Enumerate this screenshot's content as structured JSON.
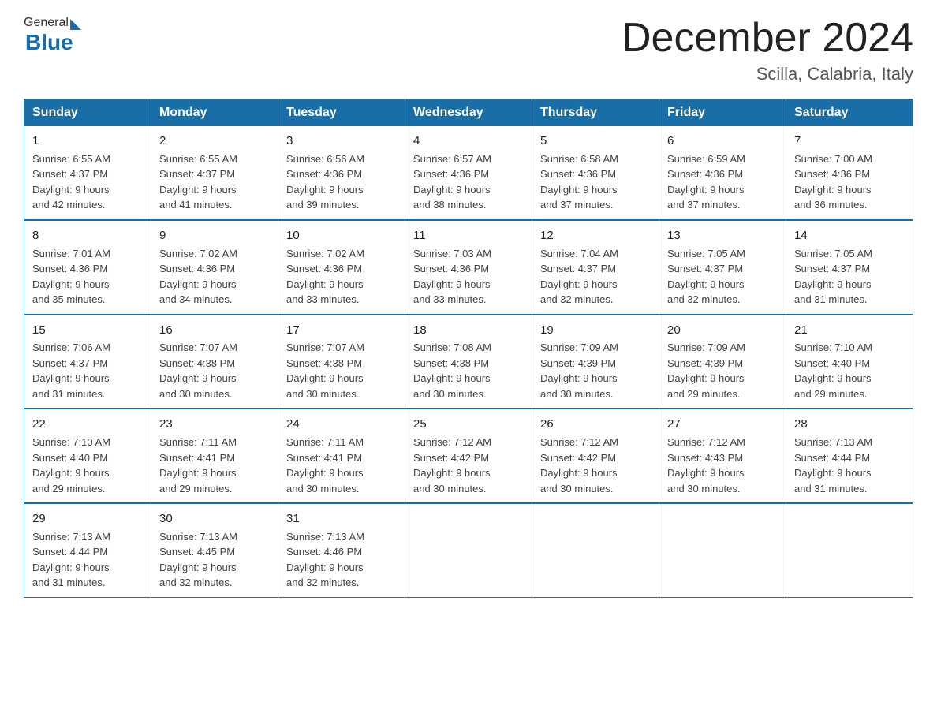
{
  "header": {
    "logo_general": "General",
    "logo_blue": "Blue",
    "title": "December 2024",
    "location": "Scilla, Calabria, Italy"
  },
  "calendar": {
    "days_of_week": [
      "Sunday",
      "Monday",
      "Tuesday",
      "Wednesday",
      "Thursday",
      "Friday",
      "Saturday"
    ],
    "weeks": [
      [
        {
          "day": "1",
          "sunrise": "6:55 AM",
          "sunset": "4:37 PM",
          "daylight": "9 hours and 42 minutes."
        },
        {
          "day": "2",
          "sunrise": "6:55 AM",
          "sunset": "4:37 PM",
          "daylight": "9 hours and 41 minutes."
        },
        {
          "day": "3",
          "sunrise": "6:56 AM",
          "sunset": "4:36 PM",
          "daylight": "9 hours and 39 minutes."
        },
        {
          "day": "4",
          "sunrise": "6:57 AM",
          "sunset": "4:36 PM",
          "daylight": "9 hours and 38 minutes."
        },
        {
          "day": "5",
          "sunrise": "6:58 AM",
          "sunset": "4:36 PM",
          "daylight": "9 hours and 37 minutes."
        },
        {
          "day": "6",
          "sunrise": "6:59 AM",
          "sunset": "4:36 PM",
          "daylight": "9 hours and 37 minutes."
        },
        {
          "day": "7",
          "sunrise": "7:00 AM",
          "sunset": "4:36 PM",
          "daylight": "9 hours and 36 minutes."
        }
      ],
      [
        {
          "day": "8",
          "sunrise": "7:01 AM",
          "sunset": "4:36 PM",
          "daylight": "9 hours and 35 minutes."
        },
        {
          "day": "9",
          "sunrise": "7:02 AM",
          "sunset": "4:36 PM",
          "daylight": "9 hours and 34 minutes."
        },
        {
          "day": "10",
          "sunrise": "7:02 AM",
          "sunset": "4:36 PM",
          "daylight": "9 hours and 33 minutes."
        },
        {
          "day": "11",
          "sunrise": "7:03 AM",
          "sunset": "4:36 PM",
          "daylight": "9 hours and 33 minutes."
        },
        {
          "day": "12",
          "sunrise": "7:04 AM",
          "sunset": "4:37 PM",
          "daylight": "9 hours and 32 minutes."
        },
        {
          "day": "13",
          "sunrise": "7:05 AM",
          "sunset": "4:37 PM",
          "daylight": "9 hours and 32 minutes."
        },
        {
          "day": "14",
          "sunrise": "7:05 AM",
          "sunset": "4:37 PM",
          "daylight": "9 hours and 31 minutes."
        }
      ],
      [
        {
          "day": "15",
          "sunrise": "7:06 AM",
          "sunset": "4:37 PM",
          "daylight": "9 hours and 31 minutes."
        },
        {
          "day": "16",
          "sunrise": "7:07 AM",
          "sunset": "4:38 PM",
          "daylight": "9 hours and 30 minutes."
        },
        {
          "day": "17",
          "sunrise": "7:07 AM",
          "sunset": "4:38 PM",
          "daylight": "9 hours and 30 minutes."
        },
        {
          "day": "18",
          "sunrise": "7:08 AM",
          "sunset": "4:38 PM",
          "daylight": "9 hours and 30 minutes."
        },
        {
          "day": "19",
          "sunrise": "7:09 AM",
          "sunset": "4:39 PM",
          "daylight": "9 hours and 30 minutes."
        },
        {
          "day": "20",
          "sunrise": "7:09 AM",
          "sunset": "4:39 PM",
          "daylight": "9 hours and 29 minutes."
        },
        {
          "day": "21",
          "sunrise": "7:10 AM",
          "sunset": "4:40 PM",
          "daylight": "9 hours and 29 minutes."
        }
      ],
      [
        {
          "day": "22",
          "sunrise": "7:10 AM",
          "sunset": "4:40 PM",
          "daylight": "9 hours and 29 minutes."
        },
        {
          "day": "23",
          "sunrise": "7:11 AM",
          "sunset": "4:41 PM",
          "daylight": "9 hours and 29 minutes."
        },
        {
          "day": "24",
          "sunrise": "7:11 AM",
          "sunset": "4:41 PM",
          "daylight": "9 hours and 30 minutes."
        },
        {
          "day": "25",
          "sunrise": "7:12 AM",
          "sunset": "4:42 PM",
          "daylight": "9 hours and 30 minutes."
        },
        {
          "day": "26",
          "sunrise": "7:12 AM",
          "sunset": "4:42 PM",
          "daylight": "9 hours and 30 minutes."
        },
        {
          "day": "27",
          "sunrise": "7:12 AM",
          "sunset": "4:43 PM",
          "daylight": "9 hours and 30 minutes."
        },
        {
          "day": "28",
          "sunrise": "7:13 AM",
          "sunset": "4:44 PM",
          "daylight": "9 hours and 31 minutes."
        }
      ],
      [
        {
          "day": "29",
          "sunrise": "7:13 AM",
          "sunset": "4:44 PM",
          "daylight": "9 hours and 31 minutes."
        },
        {
          "day": "30",
          "sunrise": "7:13 AM",
          "sunset": "4:45 PM",
          "daylight": "9 hours and 32 minutes."
        },
        {
          "day": "31",
          "sunrise": "7:13 AM",
          "sunset": "4:46 PM",
          "daylight": "9 hours and 32 minutes."
        },
        null,
        null,
        null,
        null
      ]
    ],
    "labels": {
      "sunrise": "Sunrise:",
      "sunset": "Sunset:",
      "daylight": "Daylight:"
    }
  }
}
